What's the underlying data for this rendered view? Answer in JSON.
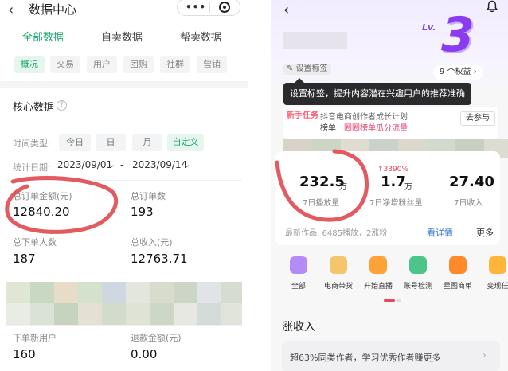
{
  "left": {
    "header": {
      "back": "‹",
      "title": "数据中心"
    },
    "tabs": [
      {
        "label": "全部数据",
        "active": true
      },
      {
        "label": "自卖数据",
        "active": false
      },
      {
        "label": "帮卖数据",
        "active": false
      }
    ],
    "chips": [
      {
        "label": "概况",
        "active": true
      },
      {
        "label": "交易",
        "active": false
      },
      {
        "label": "用户",
        "active": false
      },
      {
        "label": "团购",
        "active": false
      },
      {
        "label": "社群",
        "active": false
      },
      {
        "label": "营销",
        "active": false
      }
    ],
    "section_title": "核心数据",
    "help": "?",
    "time_type_label": "时间类型:",
    "time_options": [
      {
        "label": "今日",
        "active": false
      },
      {
        "label": "日",
        "active": false
      },
      {
        "label": "月",
        "active": false
      },
      {
        "label": "自定义",
        "active": true
      }
    ],
    "date_label": "统计日期:",
    "date_start": "2023/09/01",
    "date_sep": "-",
    "date_end": "2023/09/14",
    "metrics": [
      {
        "label": "总订单金额(元)",
        "value": "12840.20"
      },
      {
        "label": "总订单数",
        "value": "193"
      },
      {
        "label": "总下单人数",
        "value": "187"
      },
      {
        "label": "总收入(元)",
        "value": "12763.71"
      },
      {
        "label": "下单新用户",
        "value": "160"
      },
      {
        "label": "退款金额(元)",
        "value": "0.00"
      }
    ]
  },
  "right": {
    "back": "‹",
    "level_prefix": "Lv.",
    "level_num": "3",
    "rights": "9 个权益 ›",
    "set_tag": "设置标签",
    "tooltip": "设置标签，提升内容潜在兴趣用户的推荐准确性",
    "task": {
      "badge": "新手任务",
      "title": "抖音电商创作者成长计划",
      "tag": "榜单",
      "link": "圈圈榜单瓜分流量",
      "go": "去参与"
    },
    "stats": [
      {
        "value": "232.5",
        "unit": "万",
        "label": "7日播放量",
        "trend": ""
      },
      {
        "value": "1.7",
        "unit": "万",
        "label": "7日净增粉丝量",
        "trend": "↑3390%"
      },
      {
        "value": "27.40",
        "unit": "",
        "label": "7日收入",
        "trend": ""
      }
    ],
    "works_line": "最新作品: 6485播放，2涨粉",
    "works_detail": "看详情",
    "works_more": "更多",
    "tools": [
      {
        "label": "全部",
        "icon": "grid-icon",
        "color": "#b58cf7"
      },
      {
        "label": "电商带货",
        "icon": "bag-icon",
        "color": "#f4c56b"
      },
      {
        "label": "开始直播",
        "icon": "live-icon",
        "color": "#ffa237"
      },
      {
        "label": "账号检测",
        "icon": "check-icon",
        "color": "#4cc48a"
      },
      {
        "label": "星图商单",
        "icon": "star-icon",
        "color": "#ff8a2c"
      },
      {
        "label": "变现任",
        "icon": "trophy-icon",
        "color": "#ffb43a"
      }
    ],
    "income_title": "涨收入",
    "income_banner": "超63%同类作者，学习优秀作者赚更多",
    "income_arrow": "›",
    "colors": {
      "accent_green": "#1aa86a",
      "level_purple": "#8a3cf0",
      "trend_red": "#e8455f",
      "link_blue": "#3a7bd5"
    }
  }
}
